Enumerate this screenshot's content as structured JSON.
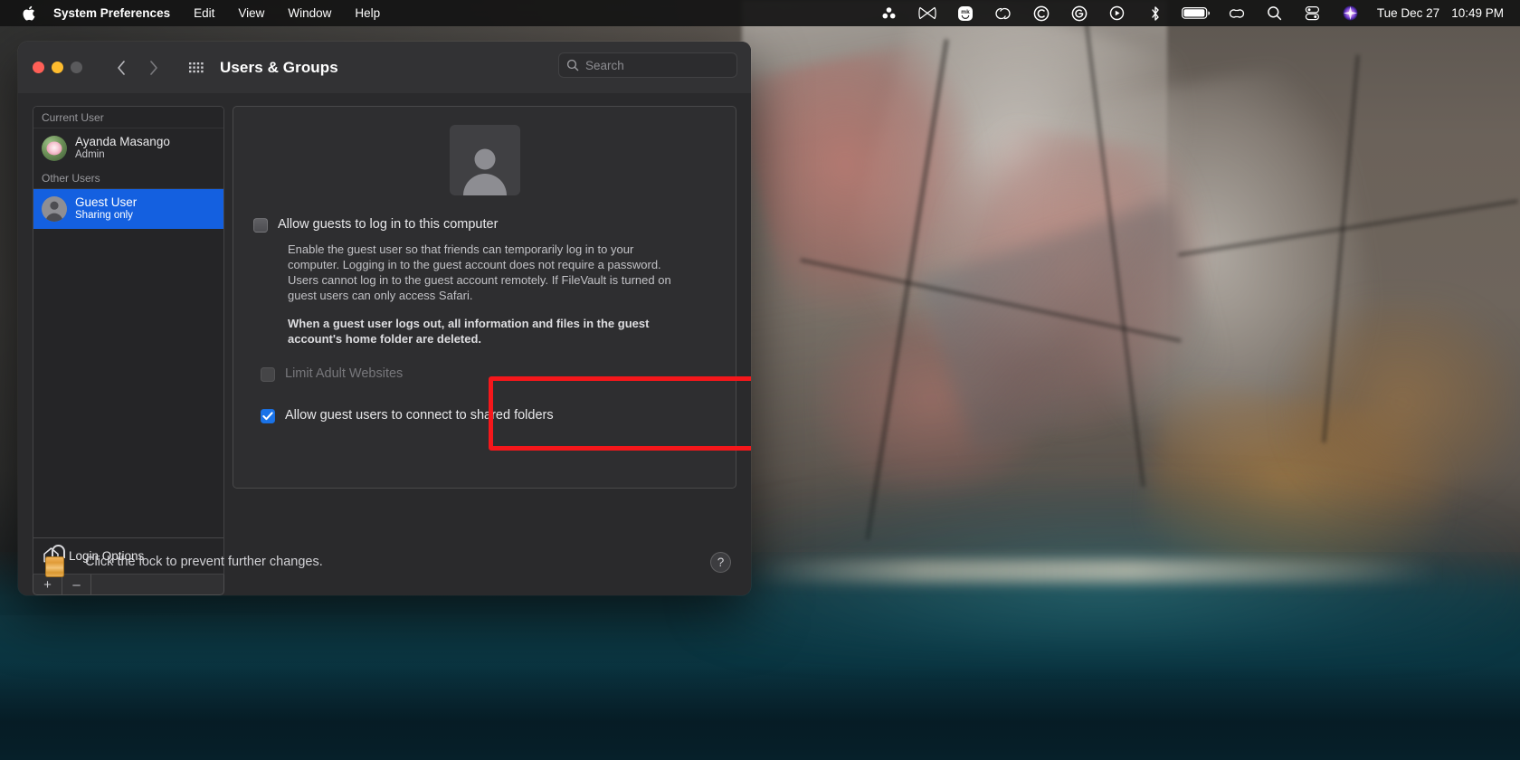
{
  "menubar": {
    "apple_icon": "apple-logo-icon",
    "items": [
      {
        "label": "System Preferences",
        "bold": true
      },
      {
        "label": "Edit",
        "bold": false
      },
      {
        "label": "View",
        "bold": false
      },
      {
        "label": "Window",
        "bold": false
      },
      {
        "label": "Help",
        "bold": false
      }
    ],
    "status_icons": [
      "asana-dots-icon",
      "butterfly-icon",
      "monkey-face-icon",
      "adobe-creative-cloud-icon",
      "letter-c-circle-icon",
      "grammarly-icon",
      "play-circle-icon",
      "bluetooth-icon",
      "battery-icon",
      "chain-link-icon",
      "search-icon",
      "control-center-icon",
      "siri-icon"
    ],
    "date": "Tue Dec 27",
    "time": "10:49 PM"
  },
  "window": {
    "title": "Users & Groups",
    "traffic_lights": [
      "close-button",
      "minimize-button",
      "zoom-button"
    ],
    "back_icon": "chevron-left-icon",
    "forward_icon": "chevron-right-icon",
    "grid_icon": "show-all-grid-icon",
    "search": {
      "placeholder": "Search",
      "icon": "search-icon",
      "value": ""
    }
  },
  "sidebar": {
    "groups": [
      {
        "header": "Current User",
        "users": [
          {
            "name": "Ayanda Masango",
            "role": "Admin",
            "avatar": "lotus-flower-avatar",
            "selected": false
          }
        ]
      },
      {
        "header": "Other Users",
        "users": [
          {
            "name": "Guest User",
            "role": "Sharing only",
            "avatar": "default-person-avatar",
            "selected": true
          }
        ]
      }
    ],
    "login_options": {
      "label": "Login Options",
      "icon": "home-icon"
    },
    "footer": {
      "add_label": "+",
      "remove_label": "–"
    }
  },
  "panel": {
    "avatar": "guest-person-avatar",
    "allow_login": {
      "label": "Allow guests to log in to this computer",
      "checked": false,
      "enabled": true
    },
    "description": "Enable the guest user so that friends can temporarily log in to your computer. Logging in to the guest account does not require a password. Users cannot log in to the guest account remotely. If FileVault is turned on guest users can only access Safari.",
    "warning": "When a guest user logs out, all information and files in the guest account's home folder are deleted.",
    "limit_adult": {
      "label": "Limit Adult Websites",
      "checked": false,
      "enabled": false
    },
    "allow_shared_folders": {
      "label": "Allow guest users to connect to shared folders",
      "checked": true,
      "enabled": true,
      "highlighted": true
    }
  },
  "footer": {
    "lock_icon": "unlocked-padlock-icon",
    "lock_text": "Click the lock to prevent further changes.",
    "help_label": "?"
  },
  "colors": {
    "selection_blue": "#1460e0",
    "checkbox_blue": "#1a73e8",
    "annotation_red": "#f5171b",
    "lock_gold": "#e09b38"
  }
}
